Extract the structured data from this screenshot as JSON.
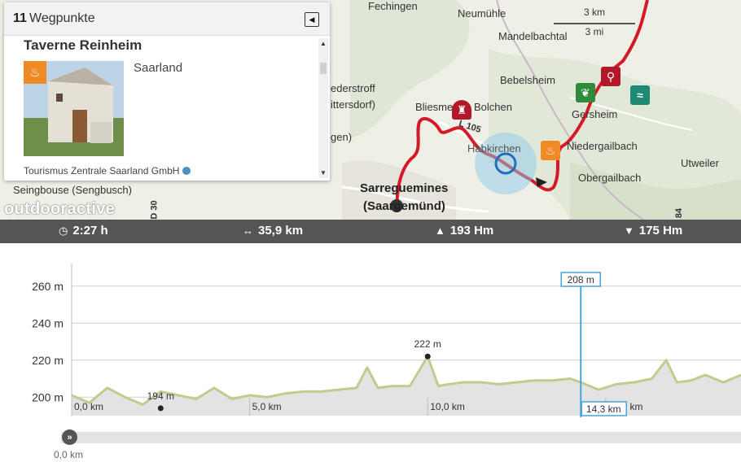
{
  "map": {
    "towns": {
      "fechingen": "Fechingen",
      "neumuehle": "Neumühle",
      "mandelbachtal": "Mandelbachtal",
      "bebelsheim": "Bebelsheim",
      "gersheim": "Gersheim",
      "bliesmengen": "Bliesmen",
      "bolchen": "Bolchen",
      "habkirchen": "Habkirchen",
      "niedergailbach": "Niedergailbach",
      "obergailbach": "Obergailbach",
      "utweiler": "Utweiler",
      "seingbouse": "Seingbouse (Sengbusch)",
      "sarreguemines": "Sarreguemines",
      "saargemuend": "(Saargemünd)",
      "lederstroff": "ederstroff",
      "rittersdorf": "ittersdorf)",
      "hagen": "gen)",
      "road_l105": "L 105",
      "road_d30": "D 30",
      "road_84": "84"
    },
    "scale": {
      "km": "3 km",
      "mi": "3 mi"
    },
    "brand": "outdooractive",
    "colors": {
      "route": "#d31a28",
      "accent": "#1f6fbf"
    }
  },
  "panel": {
    "count": "11",
    "label": "Wegpunkte",
    "poi": {
      "title": "Taverne Reinheim",
      "region": "Saarland",
      "source": "Tourismus Zentrale Saarland GmbH",
      "icon": "restaurant-icon"
    }
  },
  "stats": {
    "duration": "2:27 h",
    "distance": "35,9 km",
    "ascent": "193 Hm",
    "descent": "175 Hm"
  },
  "profile": {
    "slider_start": "0,0 km",
    "cursor_elevation": "208 m",
    "cursor_distance": "14,3 km"
  },
  "chart_data": {
    "type": "area",
    "xlabel": "",
    "ylabel": "",
    "x_unit": "km",
    "y_unit": "m",
    "xlim": [
      0,
      35.9
    ],
    "ylim": [
      190,
      270
    ],
    "x_ticks": [
      "0,0 km",
      "5,0 km",
      "10,0 km",
      "15,0 km"
    ],
    "y_ticks": [
      "200 m",
      "220 m",
      "240 m",
      "260 m"
    ],
    "y_tick_values": [
      200,
      220,
      240,
      260
    ],
    "x_tick_values": [
      0,
      5,
      10,
      15
    ],
    "series": [
      {
        "x": [
          0,
          0.5,
          1.0,
          1.5,
          2.0,
          2.5,
          3.0,
          3.5,
          4.0,
          4.5,
          5.0,
          5.5,
          6.0,
          6.5,
          7.0,
          7.5,
          8.0,
          8.3,
          8.6,
          9.0,
          9.5,
          10.0,
          10.3,
          10.6,
          11.0,
          11.5,
          12.0,
          12.5,
          13.0,
          13.5,
          14.0,
          14.3,
          14.8,
          15.3,
          15.8,
          16.3,
          16.7,
          17.0,
          17.4,
          17.8,
          18.3,
          18.8
        ],
        "y": [
          201,
          197,
          205,
          200,
          196,
          203,
          201,
          199,
          205,
          199,
          201,
          200,
          202,
          203,
          203,
          204,
          205,
          216,
          205,
          206,
          206,
          222,
          206,
          207,
          208,
          208,
          207,
          208,
          209,
          209,
          210,
          208,
          204,
          207,
          208,
          210,
          220,
          208,
          209,
          212,
          208,
          212
        ]
      }
    ],
    "annotations": [
      {
        "label": "194 m",
        "x": 2.5,
        "y": 194
      },
      {
        "label": "222 m",
        "x": 10.0,
        "y": 222
      }
    ]
  }
}
